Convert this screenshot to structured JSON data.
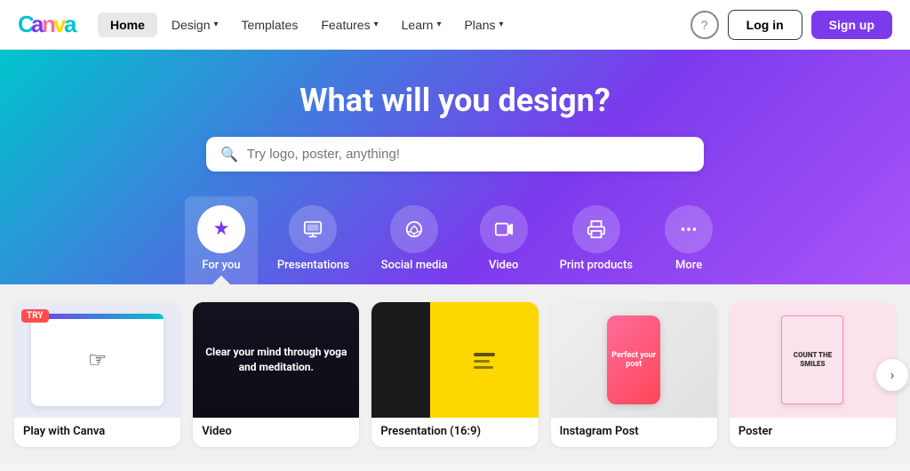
{
  "nav": {
    "logo_text": "Canva",
    "home_label": "Home",
    "items": [
      {
        "label": "Design",
        "has_dropdown": true
      },
      {
        "label": "Templates",
        "has_dropdown": false
      },
      {
        "label": "Features",
        "has_dropdown": true
      },
      {
        "label": "Learn",
        "has_dropdown": true
      },
      {
        "label": "Plans",
        "has_dropdown": true
      }
    ],
    "help_label": "?",
    "login_label": "Log in",
    "signup_label": "Sign up"
  },
  "hero": {
    "title": "What will you design?",
    "search_placeholder": "Try logo, poster, anything!"
  },
  "categories": [
    {
      "id": "for-you",
      "label": "For you",
      "icon": "✦",
      "active": true
    },
    {
      "id": "presentations",
      "label": "Presentations",
      "icon": "🖥",
      "active": false
    },
    {
      "id": "social-media",
      "label": "Social media",
      "icon": "♡",
      "active": false
    },
    {
      "id": "video",
      "label": "Video",
      "icon": "▶",
      "active": false
    },
    {
      "id": "print-products",
      "label": "Print products",
      "icon": "🖨",
      "active": false
    },
    {
      "id": "more",
      "label": "More",
      "icon": "···",
      "active": false
    }
  ],
  "cards": [
    {
      "id": "play-canva",
      "label": "Play with Canva",
      "thumb_type": "play",
      "has_try_badge": true,
      "try_label": "TRY"
    },
    {
      "id": "video",
      "label": "Video",
      "thumb_type": "video",
      "has_try_badge": false,
      "video_text": "Clear your mind through yoga and meditation."
    },
    {
      "id": "presentation",
      "label": "Presentation (16:9)",
      "thumb_type": "presentation",
      "has_try_badge": false
    },
    {
      "id": "instagram-post",
      "label": "Instagram Post",
      "thumb_type": "instagram",
      "has_try_badge": false,
      "phone_text": "Perfect your post"
    },
    {
      "id": "poster",
      "label": "Poster",
      "thumb_type": "poster",
      "has_try_badge": false,
      "poster_text": "COUNT THE SMILES"
    }
  ],
  "next_arrow": "›"
}
